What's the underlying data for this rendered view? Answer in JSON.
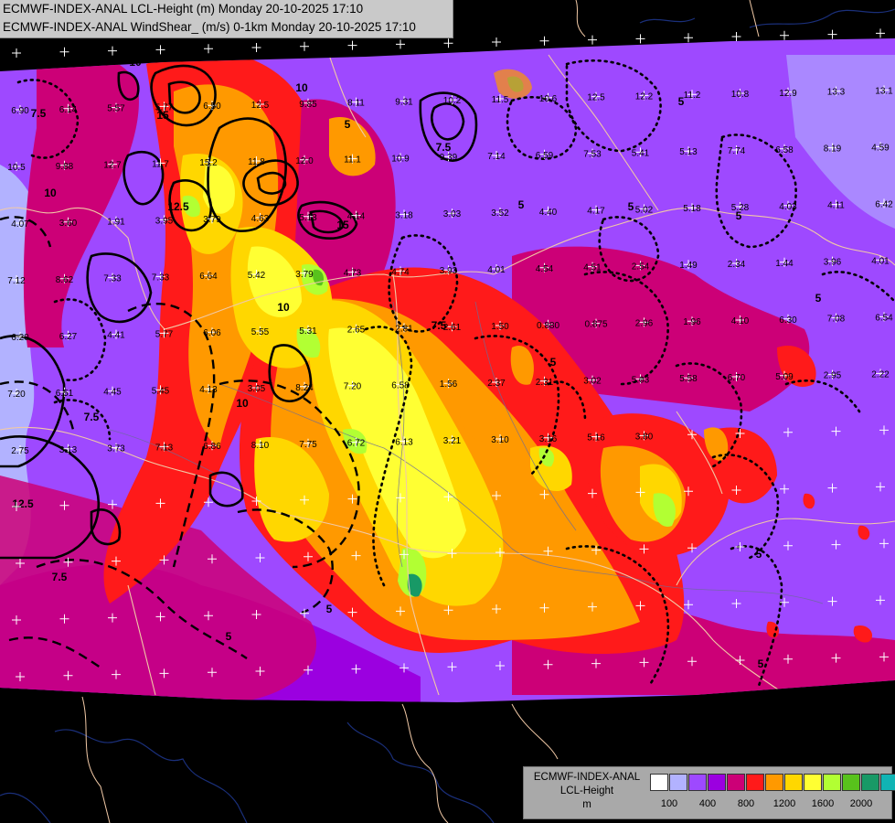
{
  "title": {
    "line1": "ECMWF-INDEX-ANAL LCL-Height (m) Monday 20-10-2025 17:10",
    "line2": "ECMWF-INDEX-ANAL WindShear_ (m/s) 0-1km Monday 20-10-2025 17:10"
  },
  "legend": {
    "model": "ECMWF-INDEX-ANAL",
    "field": "LCL-Height",
    "unit": "m",
    "colors": [
      "#ffffff",
      "#b2b2ff",
      "#9e49ff",
      "#9b00e0",
      "#cc0077",
      "#ff1a1a",
      "#ff9900",
      "#ffd700",
      "#ffff33",
      "#b2ff33",
      "#58c21c",
      "#189966",
      "#10b4b4",
      "#00aaff"
    ],
    "tick_labels": [
      "100",
      "400",
      "800",
      "1200",
      "1600",
      "2000"
    ]
  },
  "map": {
    "colors": {
      "background": "#000000",
      "borders": "#f1c9a6",
      "rivers": "#6b6b99",
      "coastline_outside": "#1a2f7a",
      "crosshair": "#ffffff"
    },
    "windshear_values": [
      "6.90",
      "6.14",
      "5.57",
      "5.77",
      "6.50",
      "12.5",
      "9.85",
      "8.11",
      "9.31",
      "10.2",
      "11.5",
      "10.6",
      "12.5",
      "12.2",
      "11.2",
      "10.8",
      "12.9",
      "13.3",
      "13.1",
      "10.5",
      "9.88",
      "12.7",
      "11.7",
      "15.2",
      "11.8",
      "12.0",
      "11.1",
      "10.9",
      "9.39",
      "7.14",
      "6.59",
      "7.53",
      "5.41",
      "5.13",
      "7.74",
      "6.58",
      "8.19",
      "4.59",
      "4.07",
      "3.60",
      "1.91",
      "3.95",
      "3.79",
      "4.63",
      "5.13",
      "4.14",
      "3.18",
      "3.03",
      "3.52",
      "4.40",
      "4.17",
      "5.02",
      "5.18",
      "5.28",
      "4.03",
      "4.11",
      "6.42",
      "7.12",
      "8.62",
      "7.33",
      "7.33",
      "6.64",
      "5.42",
      "3.79",
      "4.73",
      "4.74",
      "3.93",
      "4.01",
      "4.54",
      "4.51",
      "2.54",
      "1.49",
      "2.34",
      "1.44",
      "3.96",
      "4.01",
      "6.20",
      "6.27",
      "4.41",
      "5.77",
      "6.06",
      "5.55",
      "5.31",
      "2.65",
      "2.81",
      "2.61",
      "1.50",
      "0.880",
      "0.875",
      "2.96",
      "1.96",
      "4.10",
      "6.30",
      "7.08",
      "6.54",
      "7.20",
      "6.51",
      "4.45",
      "5.45",
      "4.13",
      "3.05",
      "8.24",
      "7.20",
      "6.58",
      "1.56",
      "2.37",
      "2.31",
      "3.02",
      "5.03",
      "5.58",
      "6.70",
      "5.09",
      "2.95",
      "2.22",
      "2.75",
      "3.13",
      "3.73",
      "7.13",
      "6.86",
      "8.10",
      "7.75",
      "6.72",
      "6.13",
      "3.21",
      "3.10",
      "3.16",
      "5.16",
      "3.80"
    ],
    "windshear_contour_labels": [
      "5",
      "7.5",
      "10",
      "12.5",
      "15"
    ]
  }
}
